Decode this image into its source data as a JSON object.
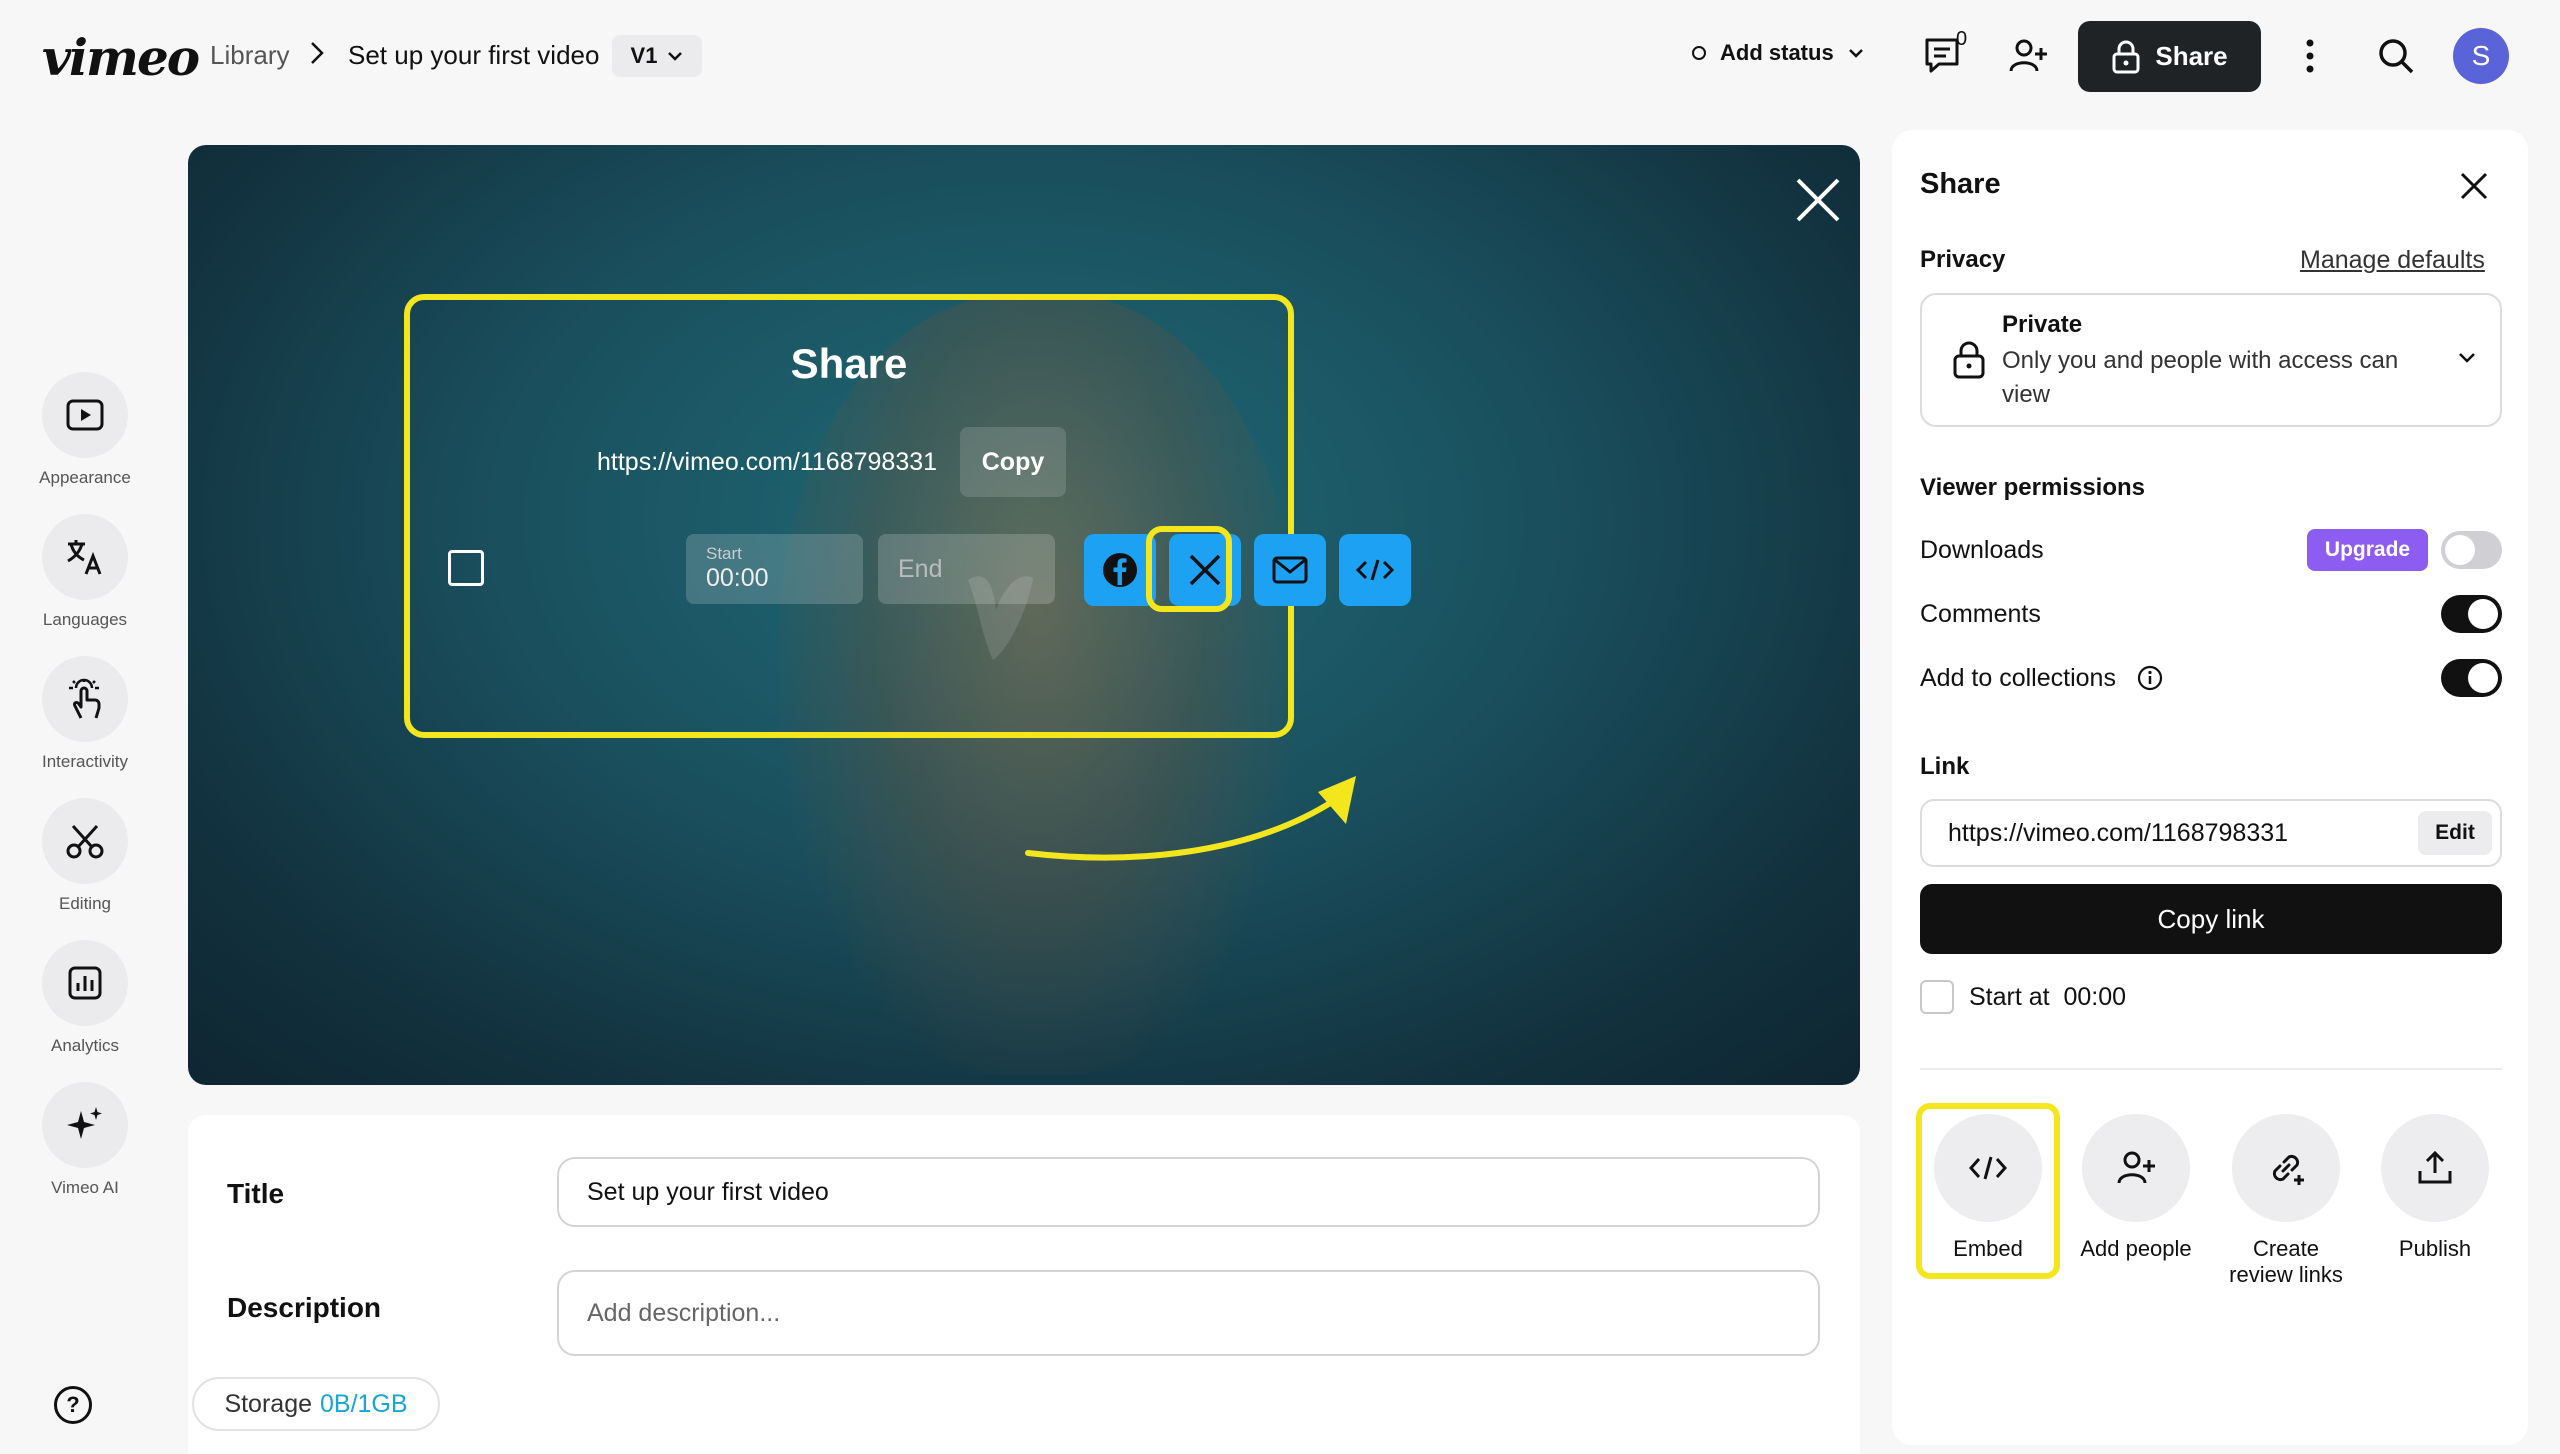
{
  "topbar": {
    "logo": "vimeo",
    "breadcrumb_library": "Library",
    "breadcrumb_current": "Set up your first video",
    "version": "V1",
    "add_status": "Add status",
    "comment_count": "0",
    "share_label": "Share",
    "avatar_initial": "S"
  },
  "rail": {
    "appearance": "Appearance",
    "languages": "Languages",
    "interactivity": "Interactivity",
    "editing": "Editing",
    "analytics": "Analytics",
    "vimeo_ai": "Vimeo AI",
    "help": "?"
  },
  "overlay": {
    "title": "Share",
    "url": "https://vimeo.com/1168798331",
    "copy": "Copy",
    "start_small": "Start",
    "start_value": "00:00",
    "end": "End"
  },
  "form": {
    "title_label": "Title",
    "title_value": "Set up your first video",
    "description_label": "Description",
    "description_placeholder": "Add description...",
    "storage_label": "Storage",
    "storage_value": "0B/1GB"
  },
  "panel": {
    "title": "Share",
    "privacy_label": "Privacy",
    "manage_defaults": "Manage defaults",
    "privacy_title": "Private",
    "privacy_desc": "Only you and people with access can view",
    "viewer_permissions": "Viewer permissions",
    "downloads": "Downloads",
    "upgrade": "Upgrade",
    "comments": "Comments",
    "add_to_collections": "Add to collections",
    "link_label": "Link",
    "link_value": "https://vimeo.com/1168798331",
    "edit": "Edit",
    "copy_link": "Copy link",
    "start_at": "Start at",
    "start_time": "00:00",
    "actions": {
      "embed": "Embed",
      "add_people": "Add people",
      "create_review_links": "Create review links",
      "publish": "Publish"
    },
    "toggles": {
      "downloads": false,
      "comments": true,
      "add_to_collections": true
    }
  },
  "colors": {
    "highlight": "#f4e61c",
    "upgrade": "#8d5cf0",
    "social": "#1da1f2",
    "avatar": "#5a63d8",
    "storage_value": "#17a5d6"
  }
}
